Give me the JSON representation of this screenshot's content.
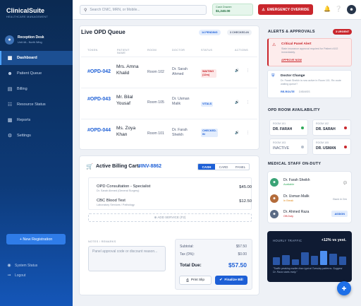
{
  "sidebar": {
    "brand": "ClinicalSuite",
    "brand_sub": "HEALTHCARE MANAGEMENT",
    "profile": {
      "name": "Reception Desk",
      "role": "Unit 4A - North Wing"
    },
    "items": [
      {
        "label": "Dashboard",
        "icon": "dashboard-icon",
        "active": true
      },
      {
        "label": "Patient Queue",
        "icon": "people-icon"
      },
      {
        "label": "Billing",
        "icon": "receipt-icon"
      },
      {
        "label": "Resource Status",
        "icon": "server-icon"
      },
      {
        "label": "Reports",
        "icon": "chart-icon"
      },
      {
        "label": "Settings",
        "icon": "gear-icon"
      }
    ],
    "new_registration": "+ New Registration",
    "system_status": "System Status",
    "logout": "Logout"
  },
  "topbar": {
    "search_placeholder": "Search CNIC, MRN, or Mobile...",
    "cash_label": "Cash Drawer:",
    "cash_value": "$1,240.00",
    "emergency": "EMERGENCY OVERRIDE"
  },
  "queue": {
    "title": "Live OPD Queue",
    "pending": "14 PENDING",
    "checked_in": "3 CHECKED-IN",
    "columns": [
      "TOKEN",
      "PATIENT NAME",
      "ROOM",
      "DOCTOR",
      "STATUS",
      "ACTIONS"
    ],
    "rows": [
      {
        "token": "#OPD-042",
        "patient": "Mrs. Amna Khalid",
        "room": "Room 102",
        "doctor": "Dr. Sarah Ahmed",
        "status": "WAITING (12m)",
        "status_color": "#c9262c",
        "status_bg": "#fde8e8"
      },
      {
        "token": "#OPD-043",
        "patient": "Mr. Bilal Yousaf",
        "room": "Room 105",
        "doctor": "Dr. Usman Malik",
        "status": "VITALS",
        "status_color": "#1d5fd6",
        "status_bg": "#e3edfd"
      },
      {
        "token": "#OPD-044",
        "patient": "Ms. Zoya Khan",
        "room": "Room 101",
        "doctor": "Dr. Farah Sheikh",
        "status": "CHECKED-IN",
        "status_color": "#1d5fd6",
        "status_bg": "#e3edfd"
      }
    ]
  },
  "billing": {
    "title": "Active Billing Cart:",
    "invoice": "#INV-8862",
    "tabs": [
      "CASH",
      "CARD",
      "PANEL"
    ],
    "items": [
      {
        "name": "OPD Consultation - Specialist",
        "sub": "Dr. Sarah Ahmed (General Surgery)",
        "price": "$45.00"
      },
      {
        "name": "CBC Blood Test",
        "sub": "Laboratory Services / Pathology",
        "price": "$12.50"
      }
    ],
    "add_service": "⊕ ADD SERVICE (F2)",
    "notes_label": "NOTES / REMARKS",
    "notes_placeholder": "Panel approval code or discount reason...",
    "subtotal_label": "Subtotal:",
    "subtotal": "$57.50",
    "tax_label": "Tax (0%):",
    "tax": "$0.00",
    "total_label": "Total Due:",
    "total": "$57.50",
    "print": "Print Slip",
    "finalize": "Finalize Bill"
  },
  "alerts": {
    "title": "ALERTS & APPROVALS",
    "urgent": "3 URGENT",
    "critical_title": "Critical Panel Alert",
    "critical_text": "State insurance approval required for Patient #102 immediately.",
    "critical_link": "APPROVE NOW",
    "doctor_title": "Doctor Change",
    "doctor_text": "Dr. Farah Sheikh is now active in Room 101. Re-route waiting queue?",
    "doctor_link": "RE-ROUTE",
    "doctor_dismiss": "DISMISS"
  },
  "rooms": {
    "title": "OPD ROOM AVAILABILITY",
    "list": [
      {
        "room": "ROOM 101",
        "doctor": "DR. FARAH",
        "color": "#2faa5a"
      },
      {
        "room": "ROOM 102",
        "doctor": "DR. SARAH",
        "color": "#c9262c"
      },
      {
        "room": "ROOM 103",
        "doctor": "INACTIVE",
        "color": "#b7c0cc"
      },
      {
        "room": "ROOM 105",
        "doctor": "DR. USMAN",
        "color": "#c9262c"
      }
    ]
  },
  "staff": {
    "title": "MEDICAL STAFF ON-DUTY",
    "list": [
      {
        "name": "Dr. Farah Sheikh",
        "status": "Available",
        "status_color": "#2faa5a",
        "right": "",
        "avatar_color": "#3aa376"
      },
      {
        "name": "Dr. Usman Malik",
        "status": "In Break",
        "status_color": "#e08a1e",
        "right": "Back in 5m",
        "avatar_color": "#b36b3a"
      },
      {
        "name": "Dr. Ahmed Raza",
        "status": "Off-Duty",
        "status_color": "#c9262c",
        "right": "ASSIGN",
        "avatar_color": "#5a6b85"
      }
    ]
  },
  "traffic": {
    "title": "HOURLY TRAFFIC",
    "change": "+12% vs yest.",
    "bars": [
      0.45,
      0.6,
      0.35,
      0.75,
      0.55,
      0.85,
      0.65,
      0.5
    ],
    "quote": "\"Traffic peaking earlier than typical Tuesday patterns. Suggest Dr. Raza starts early.\""
  }
}
